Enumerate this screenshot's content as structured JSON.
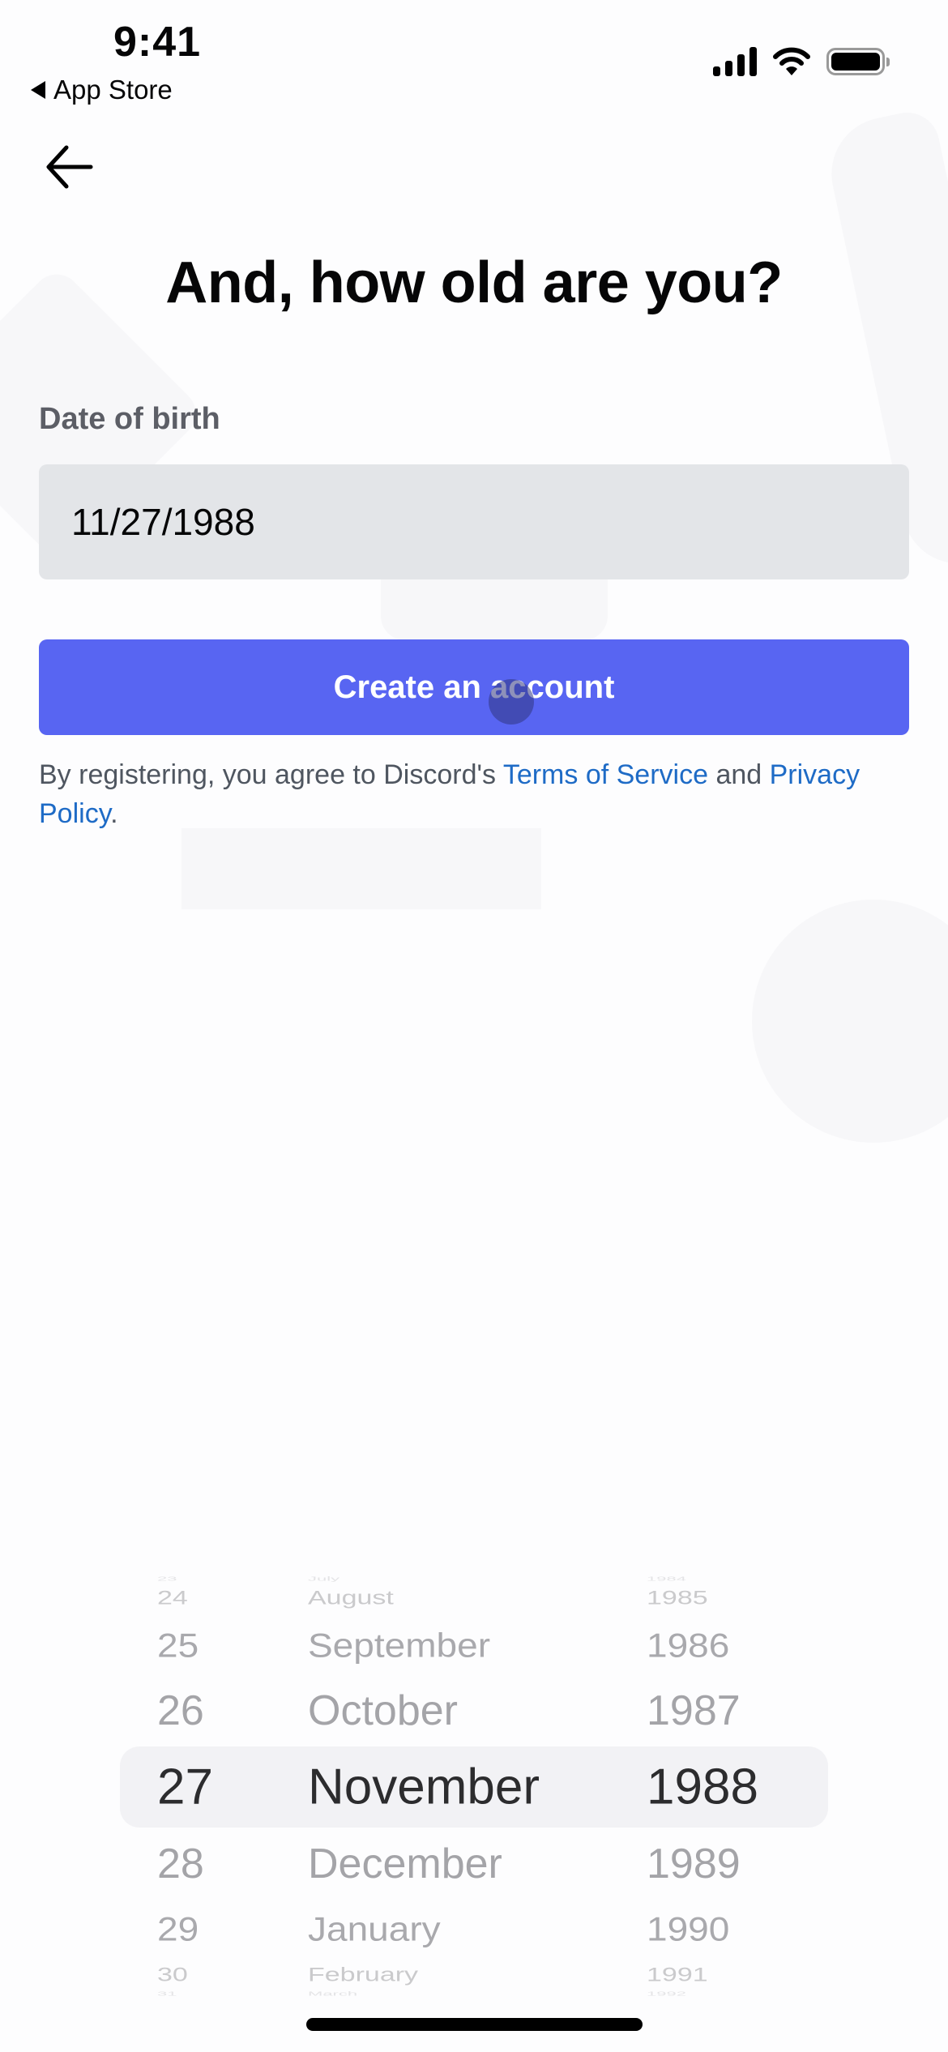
{
  "status_bar": {
    "time": "9:41",
    "back_app": "App Store",
    "icons": [
      "signal-icon",
      "wifi-icon",
      "battery-icon"
    ]
  },
  "nav": {
    "back_icon": "arrow-left-icon"
  },
  "title": "And, how old are you?",
  "form": {
    "dob_label": "Date of birth",
    "dob_value": "11/27/1988"
  },
  "cta": {
    "label": "Create an account",
    "color": "#5865f2"
  },
  "terms": {
    "prefix": "By registering, you agree to Discord's ",
    "tos_link": "Terms of Service",
    "middle": " and ",
    "privacy_link": "Privacy Policy",
    "suffix": "."
  },
  "picker": {
    "selected": {
      "day": "27",
      "month": "November",
      "year": "1988"
    },
    "rows": [
      {
        "day": "23",
        "month": "July",
        "year": "1984"
      },
      {
        "day": "24",
        "month": "August",
        "year": "1985"
      },
      {
        "day": "25",
        "month": "September",
        "year": "1986"
      },
      {
        "day": "26",
        "month": "October",
        "year": "1987"
      },
      {
        "day": "27",
        "month": "November",
        "year": "1988"
      },
      {
        "day": "28",
        "month": "December",
        "year": "1989"
      },
      {
        "day": "29",
        "month": "January",
        "year": "1990"
      },
      {
        "day": "30",
        "month": "February",
        "year": "1991"
      },
      {
        "day": "31",
        "month": "March",
        "year": "1992"
      }
    ]
  }
}
